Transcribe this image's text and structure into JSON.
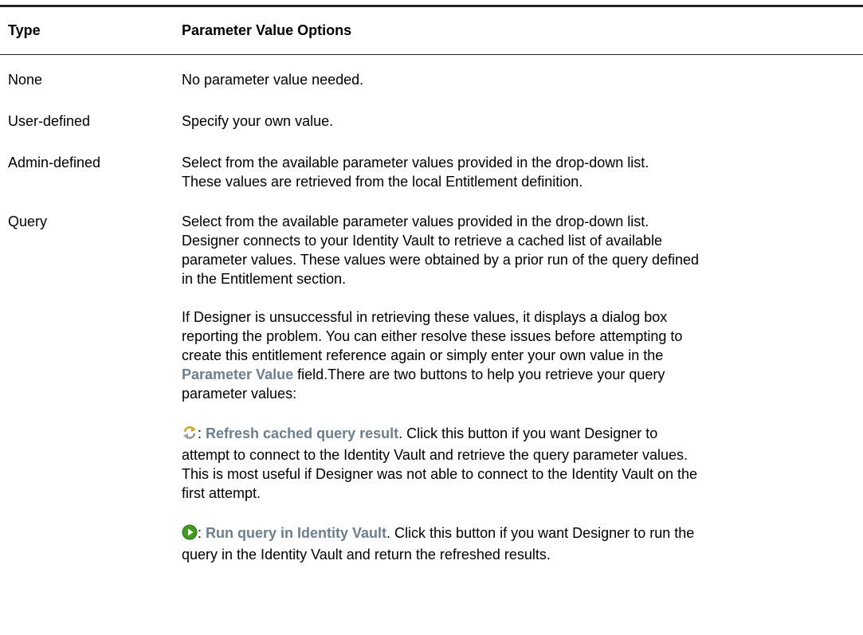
{
  "table": {
    "headers": {
      "type": "Type",
      "options": "Parameter Value Options"
    },
    "rows": [
      {
        "type": "None",
        "text": "No parameter value needed."
      },
      {
        "type": "User-defined",
        "text": "Specify your own value."
      },
      {
        "type": "Admin-defined",
        "text": "Select from the available parameter values provided in the drop-down list. These values are retrieved from the local Entitlement definition."
      },
      {
        "type": "Query",
        "text": "Select from the available parameter values provided in the drop-down list. Designer connects to your Identity Vault to retrieve a cached list of available parameter values. These values were obtained by a prior run of the query defined in the Entitlement section.",
        "para2_before": "If Designer is unsuccessful in retrieving these values, it displays a dialog box reporting the problem. You can either resolve these issues before attempting to create this entitlement reference again or simply enter your own value in the ",
        "para2_label": "Parameter Value",
        "para2_after": " field.There are two buttons to help you retrieve your query parameter values:",
        "refresh": {
          "icon": "refresh-cached-icon",
          "colon": ": ",
          "label": "Refresh cached query result",
          "text": ". Click this button if you want Designer to attempt to connect to the Identity Vault and retrieve the query parameter values. This is most useful if Designer was not able to connect to the Identity Vault on the first attempt."
        },
        "run": {
          "icon": "run-query-icon",
          "colon": ": ",
          "label": "Run query in Identity Vault",
          "text": ". Click this button if you want Designer to run the query in the Identity Vault and return the refreshed results."
        }
      }
    ]
  },
  "colors": {
    "ui_label": "#6b7f90",
    "rule": "#222222",
    "run_icon": "#3f9b22",
    "refresh_icon": "#d8a21c"
  }
}
